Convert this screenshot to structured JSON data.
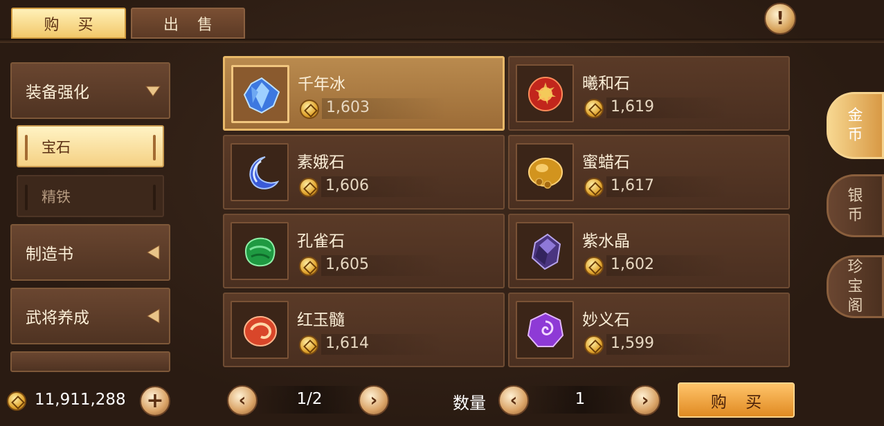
{
  "top_tabs": {
    "buy": "购 买",
    "sell": "出 售"
  },
  "info_button": "!",
  "sidebar": {
    "categories": [
      {
        "label": "装备强化",
        "arrow": "down"
      },
      {
        "label": "制造书",
        "arrow": "left"
      },
      {
        "label": "武将养成",
        "arrow": "left"
      }
    ],
    "sub_items": [
      {
        "label": "宝石",
        "selected": true
      },
      {
        "label": "精铁",
        "selected": false
      }
    ]
  },
  "wallet": {
    "amount": "11,911,288",
    "plus_label": "+"
  },
  "items": [
    {
      "name": "千年冰",
      "price": "1,603",
      "icon": "blue-ice-crystal-icon"
    },
    {
      "name": "曦和石",
      "price": "1,619",
      "icon": "red-sun-stone-icon"
    },
    {
      "name": "素娥石",
      "price": "1,606",
      "icon": "blue-moon-stone-icon"
    },
    {
      "name": "蜜蜡石",
      "price": "1,617",
      "icon": "amber-stone-icon"
    },
    {
      "name": "孔雀石",
      "price": "1,605",
      "icon": "green-malachite-icon"
    },
    {
      "name": "紫水晶",
      "price": "1,602",
      "icon": "purple-crystal-icon"
    },
    {
      "name": "红玉髓",
      "price": "1,614",
      "icon": "red-carnelian-icon"
    },
    {
      "name": "妙义石",
      "price": "1,599",
      "icon": "violet-swirl-stone-icon"
    }
  ],
  "currency_tabs": [
    {
      "label_top": "金",
      "label_bottom": "币"
    },
    {
      "label_top": "银",
      "label_bottom": "币"
    },
    {
      "label_top": "珍",
      "label_mid": "宝",
      "label_bottom": "阁"
    }
  ],
  "pagination": {
    "text": "1/2",
    "prev": "‹",
    "next": "›"
  },
  "quantity": {
    "label": "数量",
    "value": "1",
    "dec": "‹",
    "inc": "›"
  },
  "buy_button": "购 买",
  "colors": {
    "accent_gold": "#f2c86a",
    "panel": "#5a3a27",
    "buy_button": "#e08a22"
  }
}
